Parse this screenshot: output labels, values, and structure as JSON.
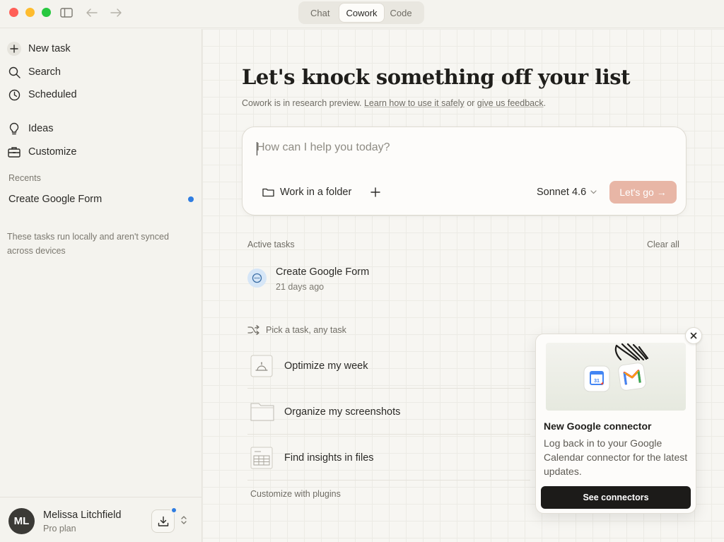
{
  "titlebar": {
    "modes": [
      "Chat",
      "Cowork",
      "Code"
    ],
    "active_mode": "Cowork"
  },
  "sidebar": {
    "nav": [
      {
        "label": "New task",
        "icon": "plus-icon"
      },
      {
        "label": "Search",
        "icon": "search-icon"
      },
      {
        "label": "Scheduled",
        "icon": "clock-icon"
      },
      {
        "label": "Ideas",
        "icon": "lightbulb-icon"
      },
      {
        "label": "Customize",
        "icon": "toolbox-icon"
      }
    ],
    "recents_label": "Recents",
    "recents": [
      {
        "label": "Create Google Form",
        "unread": true
      }
    ],
    "note": "These tasks run locally and aren't synced across devices",
    "user": {
      "initials": "ML",
      "name": "Melissa Litchfield",
      "plan": "Pro plan"
    }
  },
  "main": {
    "hero": "Let's knock something off your list",
    "sub": {
      "prefix": "Cowork is in research preview. ",
      "link1": "Learn how to use it safely",
      "middle": " or ",
      "link2": "give us feedback",
      "suffix": "."
    },
    "composer": {
      "placeholder": "How can I help you today?",
      "folder_label": "Work in a folder",
      "model": "Sonnet 4.6",
      "go_label": "Let's go →"
    },
    "active_tasks_label": "Active tasks",
    "clear_all": "Clear all",
    "active_tasks": [
      {
        "title": "Create Google Form",
        "time": "21 days ago"
      }
    ],
    "pick_label": "Pick a task, any task",
    "suggestions": [
      {
        "label": "Optimize my week",
        "icon": "bell-icon"
      },
      {
        "label": "Organize my screenshots",
        "icon": "folder-icon"
      },
      {
        "label": "Find insights in files",
        "icon": "spreadsheet-icon"
      }
    ],
    "plugins_label": "Customize with plugins"
  },
  "card": {
    "title": "New Google connector",
    "body": "Log back in to your Google Calendar connector for the latest updates.",
    "button": "See connectors",
    "calendar_badge": "31"
  },
  "colors": {
    "accent_go": "#e8b6a6",
    "unread_dot": "#2f7de1",
    "card_button": "#1c1b19"
  }
}
